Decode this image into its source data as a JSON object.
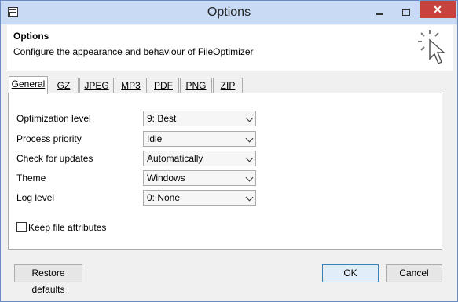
{
  "window": {
    "title": "Options"
  },
  "header": {
    "title": "Options",
    "description": "Configure the appearance and behaviour of FileOptimizer"
  },
  "tabs": [
    {
      "label": "General"
    },
    {
      "label": "GZ"
    },
    {
      "label": "JPEG"
    },
    {
      "label": "MP3"
    },
    {
      "label": "PDF"
    },
    {
      "label": "PNG"
    },
    {
      "label": "ZIP"
    }
  ],
  "settings": [
    {
      "label": "Optimization level",
      "value": "9: Best"
    },
    {
      "label": "Process priority",
      "value": "Idle"
    },
    {
      "label": "Check for updates",
      "value": "Automatically"
    },
    {
      "label": "Theme",
      "value": "Windows"
    },
    {
      "label": "Log level",
      "value": "0: None"
    }
  ],
  "keep_attributes": {
    "label": "Keep file attributes",
    "checked": false
  },
  "buttons": {
    "restore": "Restore defaults",
    "ok": "OK",
    "cancel": "Cancel"
  },
  "colors": {
    "close": "#c7423d",
    "titlebar": "#c8daf4",
    "accent": "#3c7fb1"
  },
  "icons": {
    "title": "window-icon",
    "header": "cursor-click-icon"
  }
}
